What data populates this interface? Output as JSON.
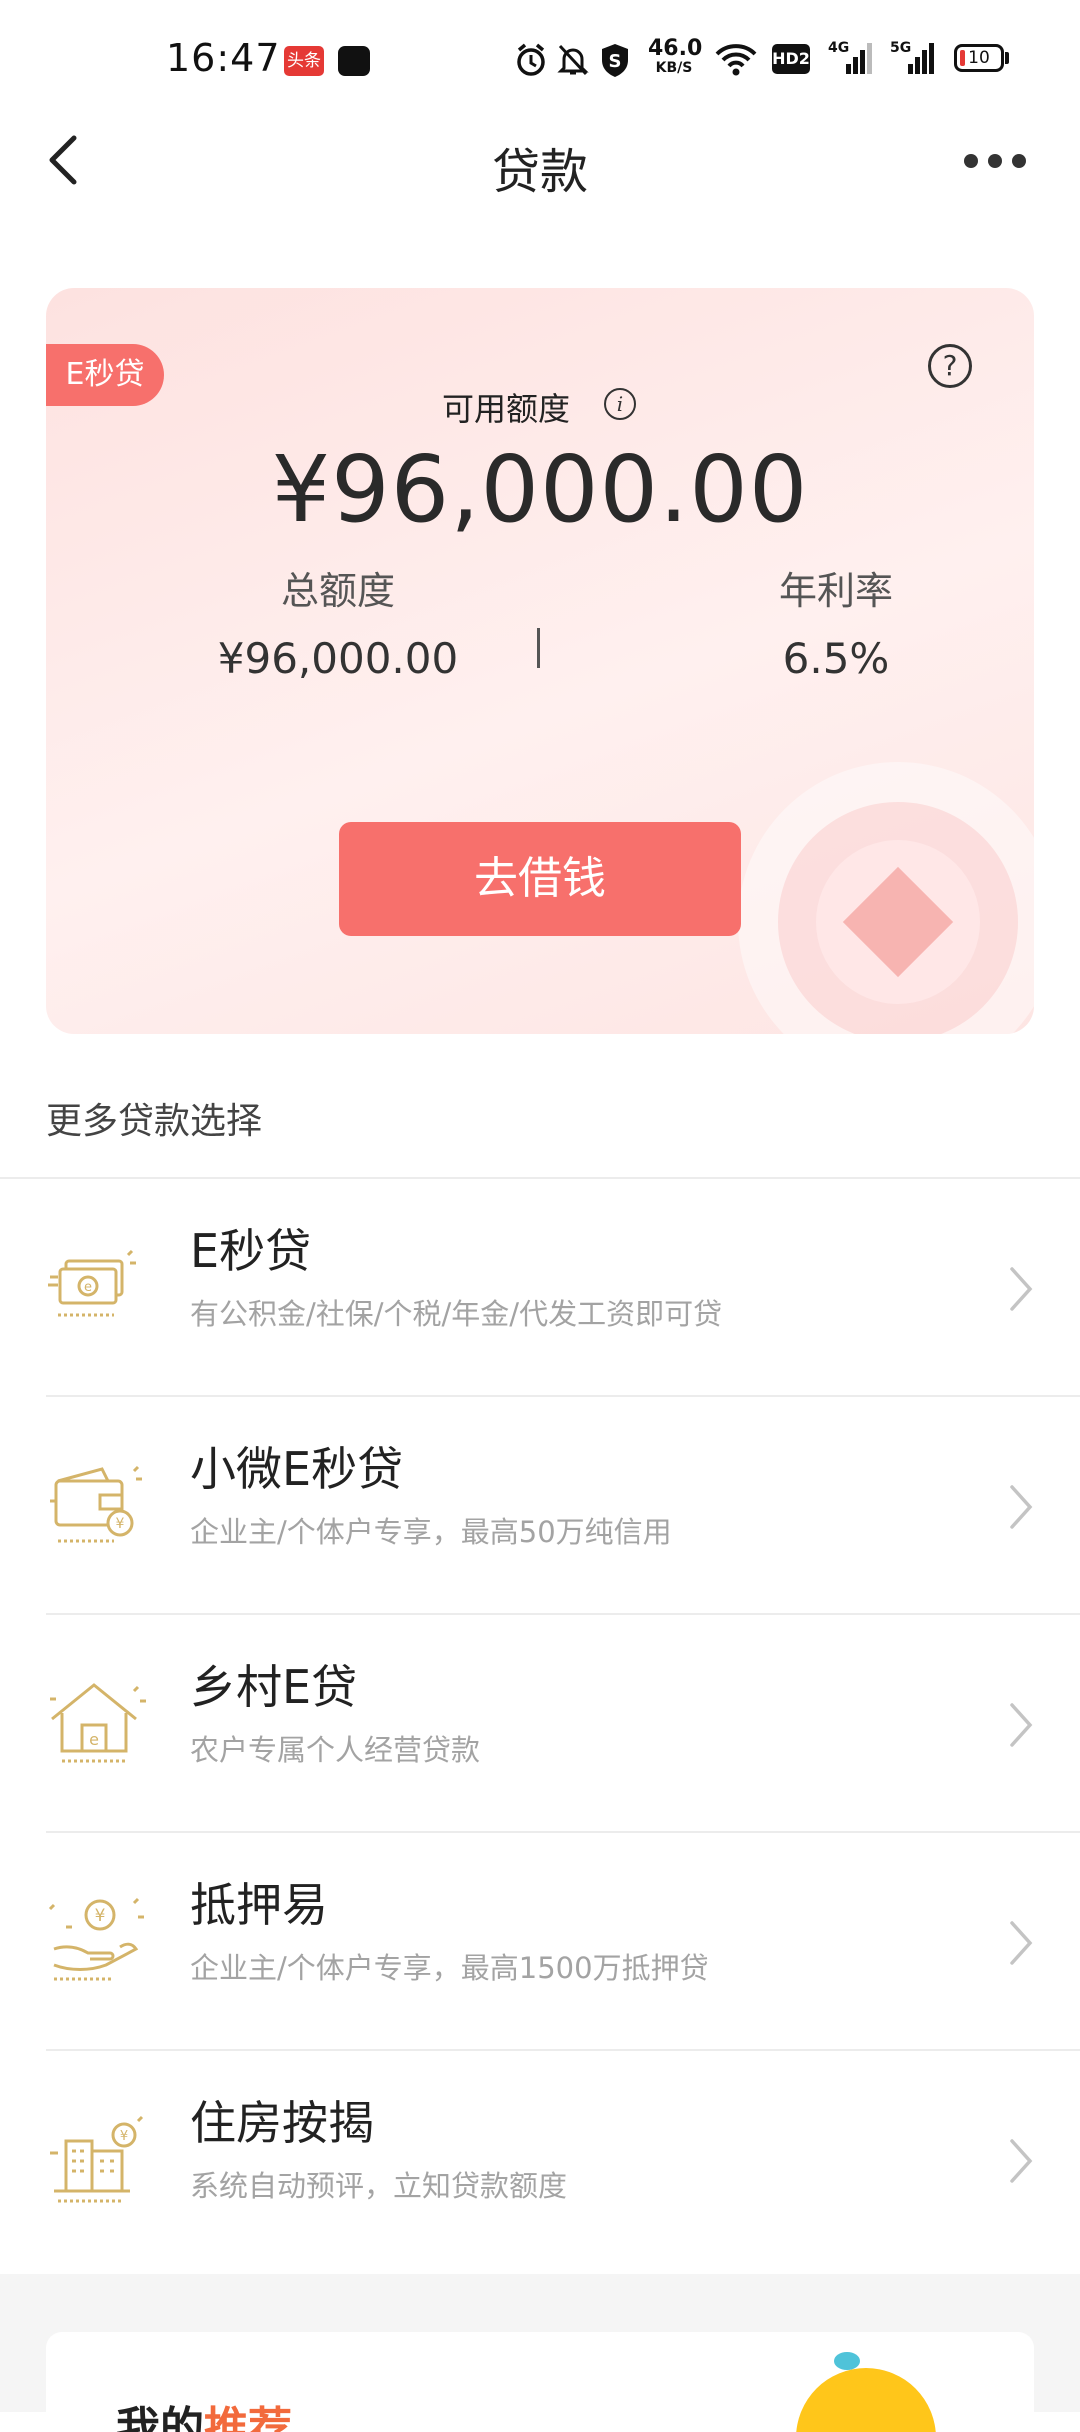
{
  "status_bar": {
    "time": "16:47",
    "app_badge_1": "头条",
    "app_badge_2": "",
    "net_speed_value": "46.0",
    "net_speed_unit": "KB/S",
    "hd_label": "HD2",
    "signal_1_label": "4G",
    "signal_2_label": "5G",
    "battery_level": "10",
    "battery_color": "#e53935"
  },
  "nav": {
    "title": "贷款",
    "back_icon": "chevron-left-icon",
    "more_icon": "more-dots-icon"
  },
  "loan_card": {
    "tag": "E秒贷",
    "available_label": "可用额度",
    "available_amount": "¥96,000.00",
    "total_label": "总额度",
    "total_value": "¥96,000.00",
    "rate_label": "年利率",
    "rate_value": "6.5%",
    "borrow_button": "去借钱",
    "accent_color": "#f7706c"
  },
  "more_loans": {
    "section_title": "更多贷款选择",
    "items": [
      {
        "name": "E秒贷",
        "desc": "有公积金/社保/个税/年金/代发工资即可贷",
        "icon": "cash-e-icon"
      },
      {
        "name": "小微E秒贷",
        "desc": "企业主/个体户专享，最高50万纯信用",
        "icon": "wallet-yen-icon"
      },
      {
        "name": "乡村E贷",
        "desc": "农户专属个人经营贷款",
        "icon": "house-e-icon"
      },
      {
        "name": "抵押易",
        "desc": "企业主/个体户专享，最高1500万抵押贷",
        "icon": "hand-coin-icon"
      },
      {
        "name": "住房按揭",
        "desc": "系统自动预评，立知贷款额度",
        "icon": "building-yen-icon"
      }
    ],
    "icon_color": "#d4b469"
  },
  "promo": {
    "title_a": "我的",
    "title_b": "推荐"
  }
}
